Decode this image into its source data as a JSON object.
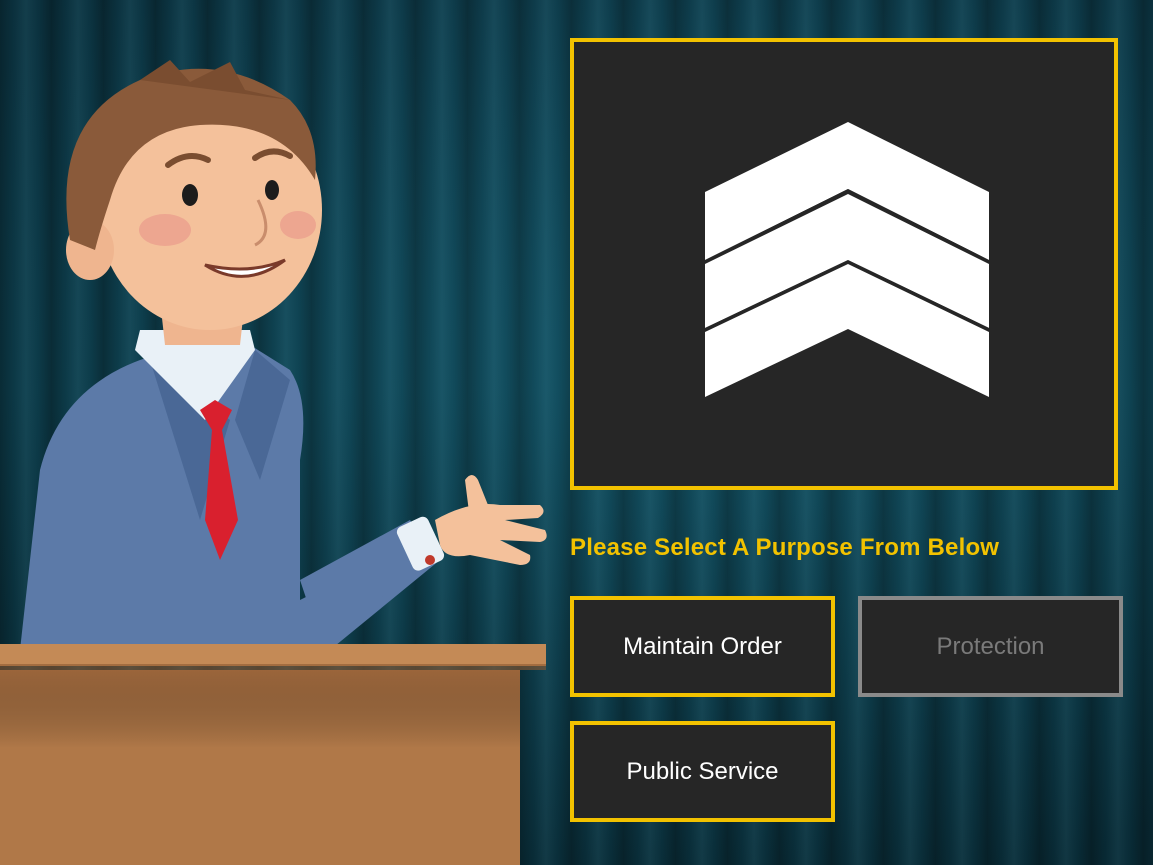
{
  "prompt": "Please Select A Purpose From Below",
  "media": {
    "icon": "chevron-rank-insignia-icon"
  },
  "options": [
    {
      "label": "Maintain Order",
      "enabled": true
    },
    {
      "label": "Protection",
      "enabled": false
    },
    {
      "label": "Public Service",
      "enabled": true
    }
  ],
  "colors": {
    "accent": "#f2c200",
    "panel": "#262626",
    "disabled_border": "#8a8a8a",
    "disabled_text": "#7a7a7a",
    "curtain": "#0f4456"
  }
}
